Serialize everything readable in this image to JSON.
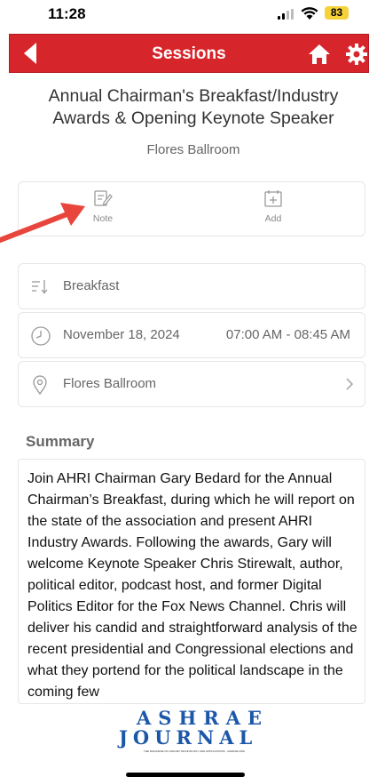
{
  "status_bar": {
    "time": "11:28",
    "battery": "83"
  },
  "header": {
    "title": "Sessions"
  },
  "session": {
    "title_line1": "Annual Chairman's Breakfast/Industry",
    "title_line2": "Awards & Opening Keynote Speaker",
    "room": "Flores Ballroom"
  },
  "actions": {
    "note_label": "Note",
    "add_label": "Add"
  },
  "details": {
    "category": "Breakfast",
    "date": "November 18, 2024",
    "time": "07:00 AM - 08:45 AM",
    "location": "Flores Ballroom"
  },
  "summary": {
    "heading": "Summary",
    "text": "Join AHRI Chairman Gary Bedard for the Annual Chairman’s Breakfast, during which he will report on the state of the association and present AHRI Industry Awards. Following the awards, Gary will welcome Keynote Speaker Chris Stirewalt, author, political editor, podcast host, and former Digital Politics Editor for the Fox News Channel. Chris will deliver his candid and straightforward analysis of the recent presidential and Congressional elections and what they portend for the political landscape in the coming few"
  },
  "logo": {
    "line1": "ASHRAE",
    "line2": "JOURNAL",
    "tagline": "THE MAGAZINE OF HVAC&R TECHNOLOGY AND APPLICATIONS · ASHRAE.ORG"
  },
  "colors": {
    "header_red": "#d7262b",
    "logo_blue": "#1d57a8",
    "arrow_red": "#e8453c"
  }
}
